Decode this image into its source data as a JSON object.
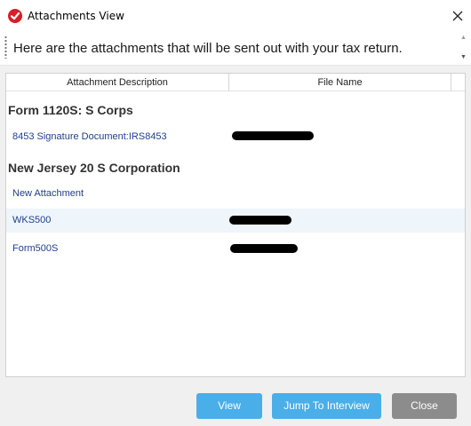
{
  "window": {
    "title": "Attachments View",
    "close_icon": "close-icon",
    "app_icon": "red-checkmark-icon"
  },
  "banner": {
    "text": "Here are the attachments that will be sent out with your tax return."
  },
  "table": {
    "headers": [
      "Attachment Description",
      "File Name"
    ],
    "groups": [
      {
        "title": "Form 1120S:  S Corps",
        "rows": [
          {
            "description": "8453 Signature Document:IRS8453"
          }
        ]
      },
      {
        "title": "New Jersey 20 S Corporation",
        "rows": [
          {
            "description": "New Attachment"
          },
          {
            "description": "WKS500"
          },
          {
            "description": "Form500S"
          }
        ]
      }
    ]
  },
  "buttons": {
    "view": "View",
    "jump": "Jump To Interview",
    "close": "Close"
  },
  "colors": {
    "accent_button": "#4aaee8",
    "close_button": "#8c8c8c",
    "link_text": "#1f3f8c",
    "selected_row": "#eef5fb"
  }
}
